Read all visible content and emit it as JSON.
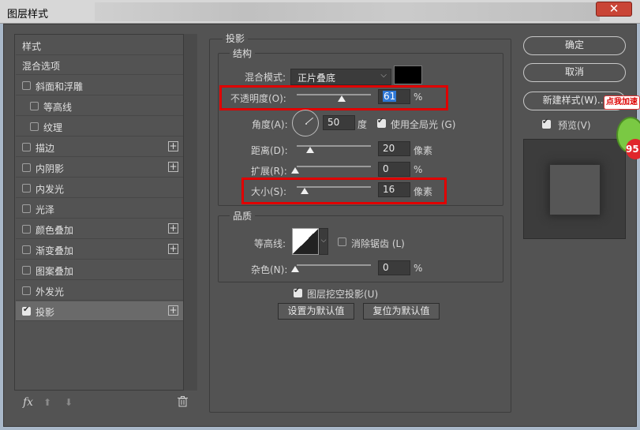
{
  "window": {
    "title": "图层样式",
    "close_symbol": "✕"
  },
  "styles_list": {
    "header": "样式",
    "blend_options": "混合选项",
    "items": [
      {
        "label": "斜面和浮雕",
        "checked": false,
        "plus": false,
        "indent": false
      },
      {
        "label": "等高线",
        "checked": false,
        "plus": false,
        "indent": true
      },
      {
        "label": "纹理",
        "checked": false,
        "plus": false,
        "indent": true
      },
      {
        "label": "描边",
        "checked": false,
        "plus": true,
        "indent": false
      },
      {
        "label": "内阴影",
        "checked": false,
        "plus": true,
        "indent": false
      },
      {
        "label": "内发光",
        "checked": false,
        "plus": false,
        "indent": false
      },
      {
        "label": "光泽",
        "checked": false,
        "plus": false,
        "indent": false
      },
      {
        "label": "颜色叠加",
        "checked": false,
        "plus": true,
        "indent": false
      },
      {
        "label": "渐变叠加",
        "checked": false,
        "plus": true,
        "indent": false
      },
      {
        "label": "图案叠加",
        "checked": false,
        "plus": false,
        "indent": false
      },
      {
        "label": "外发光",
        "checked": false,
        "plus": false,
        "indent": false
      },
      {
        "label": "投影",
        "checked": true,
        "plus": true,
        "indent": false,
        "selected": true
      }
    ],
    "fx_label": "fx",
    "icons": [
      "fx-icon",
      "move-up-icon",
      "move-down-icon",
      "trash-icon"
    ]
  },
  "drop_shadow": {
    "section_title": "投影",
    "structure_title": "结构",
    "blend_mode_label": "混合模式:",
    "blend_mode_value": "正片叠底",
    "blend_color": "#000000",
    "opacity_label": "不透明度(O):",
    "opacity_value": "61",
    "opacity_unit": "%",
    "angle_label": "角度(A):",
    "angle_value": "50",
    "angle_unit": "度",
    "global_light_label": "使用全局光 (G)",
    "global_light_checked": true,
    "distance_label": "距离(D):",
    "distance_value": "20",
    "distance_unit": "像素",
    "spread_label": "扩展(R):",
    "spread_value": "0",
    "spread_unit": "%",
    "size_label": "大小(S):",
    "size_value": "16",
    "size_unit": "像素",
    "quality_title": "品质",
    "contour_label": "等高线:",
    "antialias_label": "消除锯齿 (L)",
    "antialias_checked": false,
    "noise_label": "杂色(N):",
    "noise_value": "0",
    "noise_unit": "%",
    "knockout_label": "图层挖空投影(U)",
    "knockout_checked": true,
    "set_default_label": "设置为默认值",
    "reset_default_label": "复位为默认值"
  },
  "right_panel": {
    "ok_label": "确定",
    "cancel_label": "取消",
    "new_style_label": "新建样式(W)...",
    "preview_label": "预览(V)",
    "preview_checked": true
  },
  "overlay_badge": {
    "text": "点我加速",
    "number": "95"
  },
  "colors": {
    "highlight_box": "#e00000",
    "selection_blue": "#2f78d6",
    "panel_bg": "#535353"
  }
}
